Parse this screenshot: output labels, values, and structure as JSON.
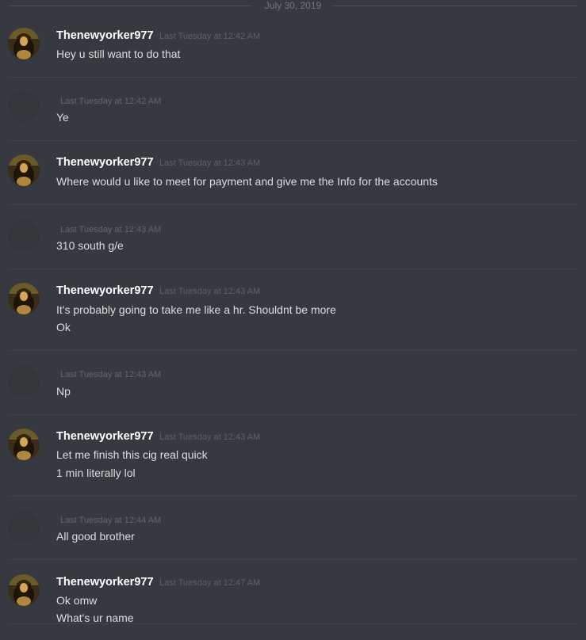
{
  "date_divider": "July 30, 2019",
  "colors": {
    "background": "#36393f",
    "username": "#ffffff",
    "message_text": "#dcddde",
    "timestamp": "#5e6168",
    "divider": "#40434a"
  },
  "messages": [
    {
      "author": "Thenewyorker977",
      "timestamp": "Last Tuesday at 12:42 AM",
      "lines": [
        "Hey u still want to do that"
      ]
    },
    {
      "author": "",
      "timestamp": "Last Tuesday at 12:42 AM",
      "lines": [
        "Ye"
      ]
    },
    {
      "author": "Thenewyorker977",
      "timestamp": "Last Tuesday at 12:43 AM",
      "lines": [
        "Where would u like to meet for payment and give me the Info for the accounts"
      ]
    },
    {
      "author": "",
      "timestamp": "Last Tuesday at 12:43 AM",
      "lines": [
        "310 south g/e"
      ]
    },
    {
      "author": "Thenewyorker977",
      "timestamp": "Last Tuesday at 12:43 AM",
      "lines": [
        "It's probably going to take me like a hr. Shouldnt be more",
        "Ok"
      ]
    },
    {
      "author": "",
      "timestamp": "Last Tuesday at 12:43 AM",
      "lines": [
        "Np"
      ]
    },
    {
      "author": "Thenewyorker977",
      "timestamp": "Last Tuesday at 12:43 AM",
      "lines": [
        "Let me finish this cig real quick",
        "1 min literally lol"
      ]
    },
    {
      "author": "",
      "timestamp": "Last Tuesday at 12:44 AM",
      "lines": [
        "All good brother"
      ]
    },
    {
      "author": "Thenewyorker977",
      "timestamp": "Last Tuesday at 12:47 AM",
      "lines": [
        "Ok omw",
        "What's ur name"
      ]
    }
  ]
}
